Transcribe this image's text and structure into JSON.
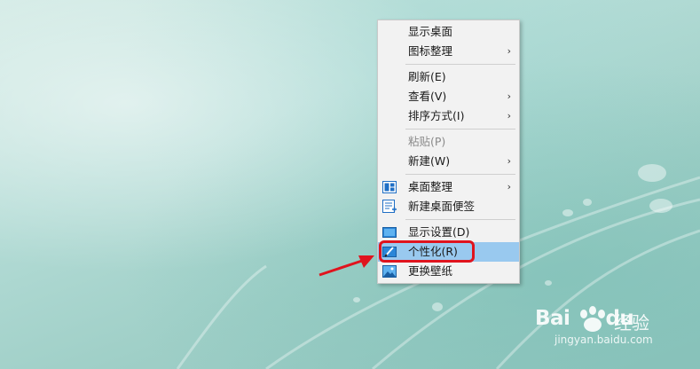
{
  "context_menu": {
    "items": [
      {
        "label": "显示桌面",
        "submenu": false
      },
      {
        "label": "图标整理",
        "submenu": true
      },
      {
        "label": "刷新(E)",
        "submenu": false
      },
      {
        "label": "查看(V)",
        "submenu": true
      },
      {
        "label": "排序方式(I)",
        "submenu": true
      },
      {
        "label": "粘贴(P)",
        "submenu": false,
        "disabled": true
      },
      {
        "label": "新建(W)",
        "submenu": true
      },
      {
        "label": "桌面整理",
        "submenu": true,
        "icon": "desktop-organize-icon"
      },
      {
        "label": "新建桌面便签",
        "submenu": false,
        "icon": "sticky-note-icon"
      },
      {
        "label": "显示设置(D)",
        "submenu": false,
        "icon": "display-icon"
      },
      {
        "label": "个性化(R)",
        "submenu": false,
        "icon": "personalize-icon",
        "highlighted": true
      },
      {
        "label": "更换壁纸",
        "submenu": false,
        "icon": "wallpaper-icon"
      }
    ],
    "chevron": "›"
  },
  "annotation": {
    "color": "#e0141e",
    "target": "个性化(R)"
  },
  "watermark": {
    "brand_a": "Bai",
    "brand_b": "du",
    "brand_cn": "经验",
    "url": "jingyan.baidu.com"
  },
  "colors": {
    "highlight": "#99c9ef",
    "menu_bg": "#f2f2f2"
  }
}
